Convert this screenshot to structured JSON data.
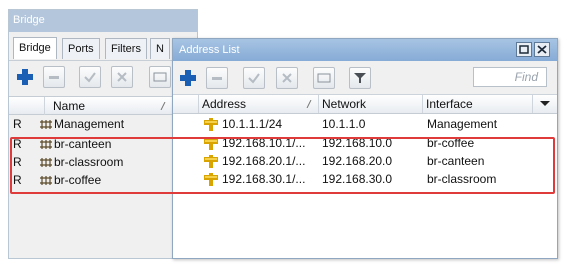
{
  "bridge": {
    "title": "Bridge",
    "tabs": [
      "Bridge",
      "Ports",
      "Filters",
      "N"
    ],
    "columns": {
      "flag": "",
      "name": "Name"
    },
    "rows": [
      {
        "flag": "R",
        "name": "Management"
      },
      {
        "flag": "R",
        "name": "br-canteen"
      },
      {
        "flag": "R",
        "name": "br-classroom"
      },
      {
        "flag": "R",
        "name": "br-coffee"
      }
    ]
  },
  "address_list": {
    "title": "Address List",
    "find_placeholder": "Find",
    "columns": {
      "address": "Address",
      "network": "Network",
      "interface": "Interface"
    },
    "rows": [
      {
        "address": "10.1.1.1/24",
        "network": "10.1.1.0",
        "interface": "Management"
      },
      {
        "address": "192.168.10.1/...",
        "network": "192.168.10.0",
        "interface": "br-coffee"
      },
      {
        "address": "192.168.20.1/...",
        "network": "192.168.20.0",
        "interface": "br-canteen"
      },
      {
        "address": "192.168.30.1/...",
        "network": "192.168.30.0",
        "interface": "br-classroom"
      }
    ]
  },
  "colors": {
    "accent_blue": "#1a5fb4",
    "highlight_red": "#e03b3b",
    "title_bar": "#86abd6"
  },
  "icons": [
    "plus-icon",
    "minus-icon",
    "check-icon",
    "cross-icon",
    "comment-icon",
    "filter-icon",
    "bridge-icon",
    "address-pin-icon",
    "sort-icon",
    "dropdown-icon",
    "maximize-icon",
    "close-icon"
  ]
}
